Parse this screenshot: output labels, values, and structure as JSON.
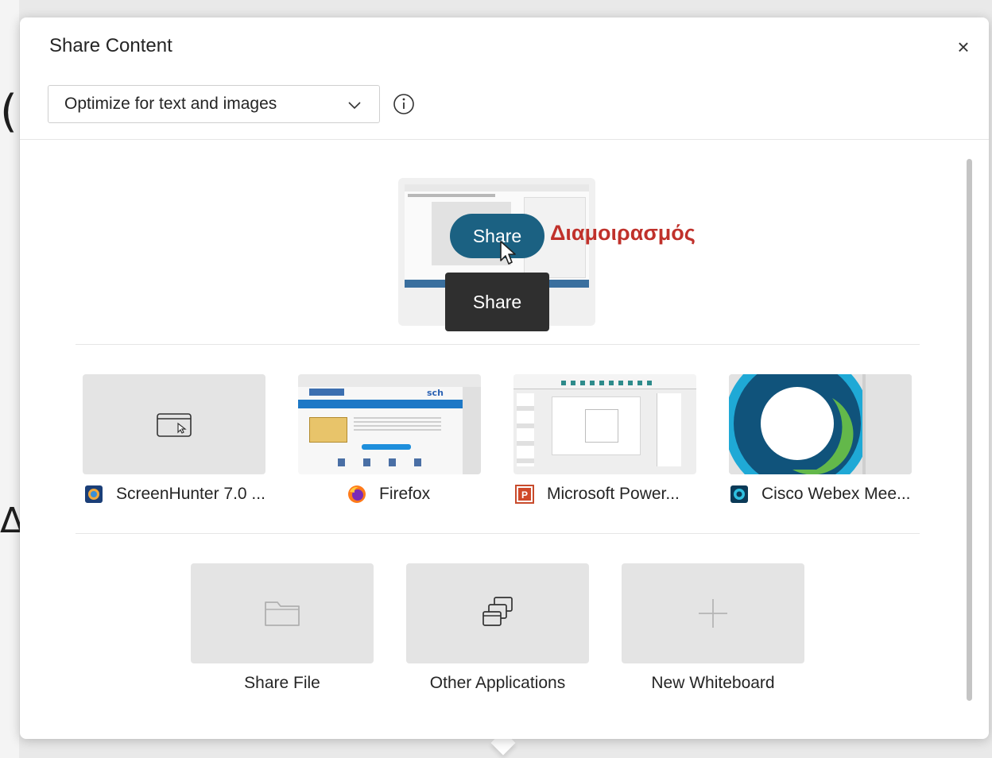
{
  "dialog": {
    "title": "Share Content",
    "close_glyph": "×",
    "optimize": {
      "selected": "Optimize for text and images"
    }
  },
  "screen_preview": {
    "share_button": "Share",
    "tooltip": "Share",
    "annotation": "Διαμοιρασμός",
    "annotation_color": "#c0312b"
  },
  "apps": [
    {
      "label": "ScreenHunter 7.0 ...",
      "icon": "screenhunter-icon"
    },
    {
      "label": "Firefox",
      "icon": "firefox-icon",
      "thumb_brand": "sch"
    },
    {
      "label": "Microsoft Power...",
      "icon": "powerpoint-icon"
    },
    {
      "label": "Cisco Webex Mee...",
      "icon": "webex-icon"
    }
  ],
  "actions": [
    {
      "label": "Share File",
      "icon": "folder-icon"
    },
    {
      "label": "Other Applications",
      "icon": "stacked-windows-icon"
    },
    {
      "label": "New Whiteboard",
      "icon": "plus-icon"
    }
  ],
  "colors": {
    "accent": "#1b6182",
    "tooltip_bg": "#2f2f2f",
    "tile_bg": "#e4e4e4"
  }
}
